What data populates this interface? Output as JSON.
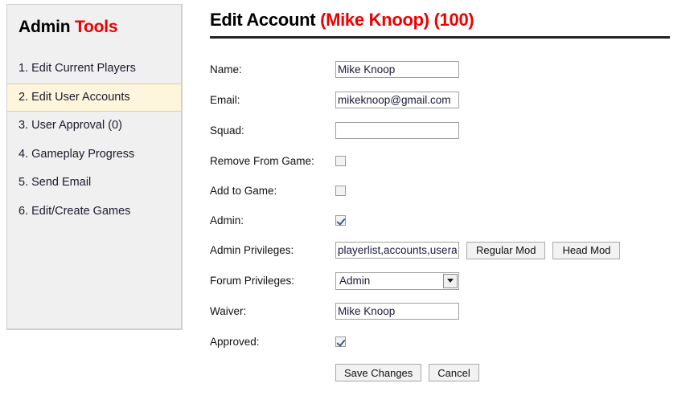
{
  "sidebar": {
    "title_main": "Admin",
    "title_accent": "Tools",
    "accent_color": "#ee0000",
    "items": [
      {
        "label": "1. Edit Current Players",
        "active": false
      },
      {
        "label": "2. Edit User Accounts",
        "active": true
      },
      {
        "label": "3. User Approval (0)",
        "active": false
      },
      {
        "label": "4. Gameplay Progress",
        "active": false
      },
      {
        "label": "5. Send Email",
        "active": false
      },
      {
        "label": "6. Edit/Create Games",
        "active": false
      }
    ]
  },
  "page": {
    "title_main": "Edit Account",
    "title_sub": "(Mike Knoop) (100)",
    "title_sub_color": "#ee0000"
  },
  "form": {
    "name": {
      "label": "Name:",
      "value": "Mike Knoop",
      "placeholder": ""
    },
    "email": {
      "label": "Email:",
      "value": "mikeknoop@gmail.com",
      "placeholder": ""
    },
    "squad": {
      "label": "Squad:",
      "value": "",
      "placeholder": ""
    },
    "remove_from_game": {
      "label": "Remove From Game:",
      "checked": false
    },
    "add_to_game": {
      "label": "Add to Game:",
      "checked": false
    },
    "admin": {
      "label": "Admin:",
      "checked": true
    },
    "admin_privileges": {
      "label": "Admin Privileges:",
      "value": "playerlist,accounts,userapproval",
      "placeholder": "",
      "regular_mod_label": "Regular Mod",
      "head_mod_label": "Head Mod"
    },
    "forum_privileges": {
      "label": "Forum Privileges:",
      "selected": "Admin",
      "options": [
        "Admin"
      ]
    },
    "waiver": {
      "label": "Waiver:",
      "value": "Mike Knoop",
      "placeholder": ""
    },
    "approved": {
      "label": "Approved:",
      "checked": true
    },
    "save_label": "Save Changes",
    "cancel_label": "Cancel"
  }
}
